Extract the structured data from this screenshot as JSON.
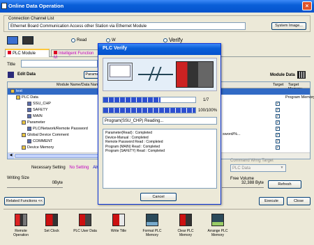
{
  "window": {
    "title": "Online Data Operation"
  },
  "connection": {
    "group_label": "Connection Channel List",
    "value": "Ethernet Board Communication  Access other Station via Ethernet Module",
    "system_image_button": "System Image..."
  },
  "modes": {
    "read": "Read",
    "write": "W",
    "verify": "Verify"
  },
  "tabs": {
    "plc_module": "PLC Module",
    "intelligent": "Intelligent Function M"
  },
  "title_label": "Title",
  "edit_data_label": "Edit Data",
  "param_label": "Parame",
  "module_data_label": "Module Data",
  "tree_header": {
    "name": "Module Name/Data Name",
    "target": "Target",
    "target_memory": "Target Memory"
  },
  "tree_rows": [
    {
      "label": "test",
      "indent": 0,
      "selected": true,
      "check": false,
      "memory": ""
    },
    {
      "label": "PLC Data",
      "indent": 1,
      "selected": false,
      "check": false,
      "memory": "Program Memory/..."
    },
    {
      "label": "SSU_CHP",
      "indent": 3,
      "selected": false,
      "check": true,
      "memory": ""
    },
    {
      "label": "SAFETY",
      "indent": 3,
      "selected": false,
      "check": true,
      "memory": ""
    },
    {
      "label": "MAIN",
      "indent": 3,
      "selected": false,
      "check": true,
      "memory": ""
    },
    {
      "label": "Parameter",
      "indent": 2,
      "selected": false,
      "check": true,
      "memory": ""
    },
    {
      "label": "PLC/Network/Remote Password",
      "indent": 3,
      "selected": false,
      "check": true,
      "memory": ""
    },
    {
      "label": "Global Device Comment",
      "indent": 2,
      "selected": false,
      "check": true,
      "memory": ""
    },
    {
      "label": "COMMENT",
      "indent": 3,
      "selected": false,
      "check": true,
      "memory": ""
    },
    {
      "label": "Device Memory",
      "indent": 2,
      "selected": false,
      "check": true,
      "memory": ""
    }
  ],
  "password_partial": "sword/%...",
  "necessary_setting": {
    "label": "Necessary Setting",
    "no_setting": "No Setting",
    "already": "Alr"
  },
  "writing_size": {
    "label": "Writing Size",
    "value": "0Byte"
  },
  "command_target": {
    "label": "Command Wrng Target",
    "value": "PLC Data"
  },
  "free_volume": {
    "label": "Free Volume",
    "value": "32,388 Byte"
  },
  "refresh_button": "Refresh",
  "related_functions_button": "Related Functions <<",
  "execute_button": "Execute",
  "close_button": "Close",
  "toolbar": [
    {
      "label": "Remote Operation",
      "icon": "remote-operation-icon"
    },
    {
      "label": "Set Clock",
      "icon": "set-clock-icon"
    },
    {
      "label": "PLC User Data",
      "icon": "plc-user-data-icon"
    },
    {
      "label": "Write Title",
      "icon": "write-title-icon"
    },
    {
      "label": "Format PLC Memory",
      "icon": "format-memory-icon"
    },
    {
      "label": "Clear PLC Memory",
      "icon": "clear-memory-icon"
    },
    {
      "label": "Arrange PLC Memory",
      "icon": "arrange-memory-icon"
    }
  ],
  "dialog": {
    "title": "PLC Verify",
    "progress1_label": "1/7",
    "progress1_fraction": 0.62,
    "progress2_label": "100/100%",
    "progress2_fraction": 1.0,
    "status_text": "Program(SSU_CHP) Reading...",
    "log": [
      "Parameter(Read) : Completed",
      "Device-Manual : Completed",
      "Remote Password Read : Completed",
      "Program (MAIN) Read : Completed",
      "Program (SAFETY) Read : Completed"
    ],
    "cancel_button": "Cancel"
  },
  "colors": {
    "titlebar": "#0553cd",
    "selection": "#316ac5",
    "no_setting": "#c000c0",
    "progress": "#2d4fd0"
  }
}
